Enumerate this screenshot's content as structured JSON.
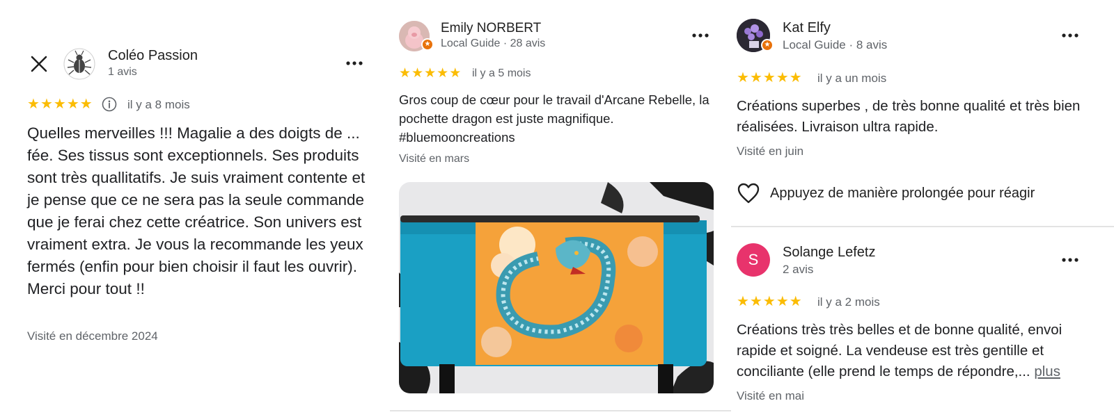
{
  "review1": {
    "close_icon": "close-icon",
    "name": "Coléo Passion",
    "reviews_count": "1 avis",
    "more_icon": "more-horizontal-icon",
    "rating": 5,
    "info_icon": "info-icon",
    "time": "il y a 8 mois",
    "text": "Quelles merveilles !!! Magalie a des doigts de ... fée. Ses tissus sont exceptionnels. Ses produits sont très quallitatifs. Je suis vraiment contente et je pense que ce ne sera pas la seule commande que je ferai chez cette créatrice. Son univers est vraiment extra. Je vous la recommande les yeux fermés (enfin pour bien choisir il faut les ouvrir). Merci pour tout !!",
    "visited": "Visité en décembre 2024"
  },
  "review2": {
    "name": "Emily NORBERT",
    "meta": "Local Guide · 28 avis",
    "more_icon": "more-horizontal-icon",
    "rating": 5,
    "time": "il y a 5 mois",
    "text": "Gros coup de cœur pour le travail d'Arcane Rebelle, la pochette dragon est juste magnifique. #bluemooncreations",
    "visited": "Visité en mars",
    "photo_icon": "dragon-pouch-photo"
  },
  "review3": {
    "name": "Kat Elfy",
    "meta": "Local Guide · 8 avis",
    "more_icon": "more-horizontal-icon",
    "rating": 5,
    "time": "il y a un mois",
    "text": "Créations superbes , de très bonne qualité et très bien réalisées. Livraison ultra rapide.",
    "visited": "Visité en juin",
    "react_label": "Appuyez de manière prolongée pour réagir",
    "heart_icon": "heart-outline-icon"
  },
  "review4": {
    "avatar_letter": "S",
    "name": "Solange Lefetz",
    "reviews_count": "2 avis",
    "more_icon": "more-horizontal-icon",
    "rating": 5,
    "time": "il y a 2 mois",
    "text": "Créations très très belles et de bonne qualité, envoi rapide et soigné. La vendeuse est très gentille et conciliante (elle prend le temps de répondre,...",
    "more_link": "plus",
    "visited": "Visité en mai"
  },
  "colors": {
    "star": "#fbbc04",
    "guide_badge": "#e8710a",
    "avatar_s": "#e8336c",
    "secondary_text": "#5f6368",
    "divider": "#e3e3e3"
  }
}
